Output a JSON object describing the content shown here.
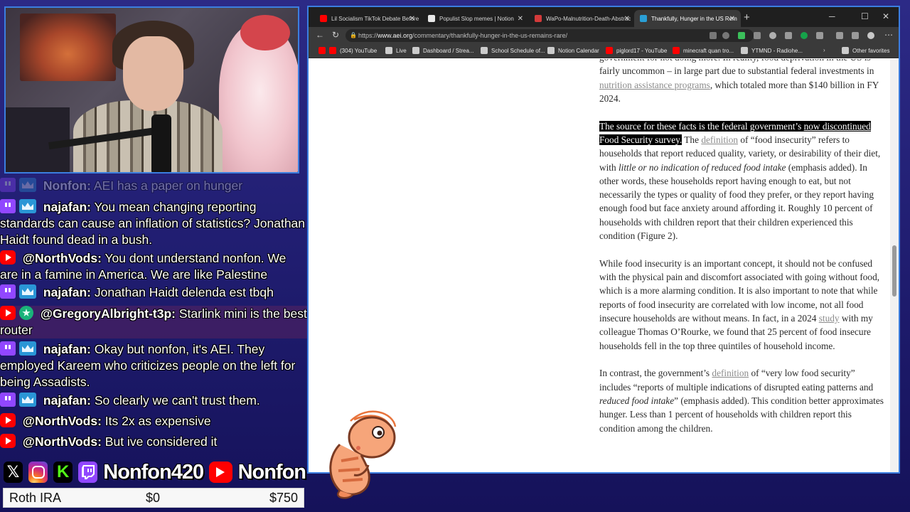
{
  "chat": {
    "messages": [
      {
        "platform": "twitch",
        "badge": "crown",
        "user": "Nonfon:",
        "text": "AEI has a paper on hunger",
        "faded": true
      },
      {
        "platform": "twitch",
        "badge": "crown",
        "user": "najafan:",
        "text": "You mean changing reporting standards can cause an inflation of statistics? Jonathan Haidt found dead in a bush."
      },
      {
        "platform": "youtube",
        "badge": "",
        "user": "@NorthVods:",
        "text": "You dont understand nonfon. We are in a famine in America. We are like Palestine"
      },
      {
        "platform": "twitch",
        "badge": "crown",
        "user": "najafan:",
        "text": "Jonathan Haidt delenda est tbqh"
      },
      {
        "platform": "youtube",
        "badge": "star",
        "user": "@GregoryAlbright-t3p:",
        "text": "Starlink mini is the best router"
      },
      {
        "platform": "twitch",
        "badge": "crown",
        "user": "najafan:",
        "text": "Okay but nonfon, it's AEI. They employed Kareem who criticizes people on the left for being Assadists."
      },
      {
        "platform": "twitch",
        "badge": "crown",
        "user": "najafan:",
        "text": "So clearly we can't trust them."
      },
      {
        "platform": "youtube",
        "badge": "",
        "user": "@NorthVods:",
        "text": "Its 2x as expensive"
      },
      {
        "platform": "youtube",
        "badge": "",
        "user": "@NorthVods:",
        "text": "But ive considered it"
      }
    ]
  },
  "socials": {
    "twitch_name": "Nonfon420",
    "youtube_name": "Nonfon",
    "icons": [
      "x-icon",
      "instagram-icon",
      "kick-icon",
      "twitch-icon",
      "youtube-icon"
    ]
  },
  "roth": {
    "label": "Roth IRA",
    "current": "$0",
    "goal": "$750"
  },
  "browser": {
    "tabs": [
      {
        "title": "Lil Socialism TikTok Debate Before",
        "icon": "youtube-icon",
        "color": "#ff0000",
        "active": false
      },
      {
        "title": "Populist Slop memes | Notion",
        "icon": "notion-icon",
        "color": "#e8e8e8",
        "active": false
      },
      {
        "title": "WaPo-Malnutrition-Death-Abstrac",
        "icon": "pdf-icon",
        "color": "#d33a3a",
        "active": false
      },
      {
        "title": "Thankfully, Hunger in the US Rem",
        "icon": "aei-icon",
        "color": "#2a9fd6",
        "active": true
      }
    ],
    "new_tab": "+",
    "window_controls": {
      "minimize": "─",
      "maximize": "☐",
      "close": "✕"
    },
    "url_prefix": "https://",
    "url_host": "www.aei.org",
    "url_path": "/commentary/thankfully-hunger-in-the-us-remains-rare/",
    "bookmarks": [
      {
        "label": "(304) YouTube",
        "color": "#ff0000"
      },
      {
        "label": "Live",
        "color": "#cccccc"
      },
      {
        "label": "Dashboard / Strea...",
        "color": "#cccccc"
      },
      {
        "label": "School Schedule of...",
        "color": "#cccccc"
      },
      {
        "label": "Notion Calendar",
        "color": "#cccccc"
      },
      {
        "label": "piglord17 - YouTube",
        "color": "#ff0000"
      },
      {
        "label": "minecraft quan tro...",
        "color": "#ff0000"
      },
      {
        "label": "YTMND - Radiohe...",
        "color": "#cccccc"
      },
      {
        "label": "Other favorites",
        "color": "#cccccc"
      }
    ]
  },
  "article": {
    "p1_text": "government for not doing more. In reality, food deprivation in the US is fairly uncommon – in large part due to substantial federal investments in ",
    "p1_link": "nutrition assistance programs",
    "p1_tail": ", which totaled more than $140 billion in FY 2024.",
    "p2_sel_a": "The source for these facts is the federal government’s ",
    "p2_sel_link": "now discontinued",
    "p2_sel_b": " Food Security survey.",
    "p2_mid": " The ",
    "p2_link": "definition",
    "p2_b": " of “food insecurity” refers to households that report reduced quality, variety, or desirability of their diet, with ",
    "p2_em": "little or no indication of reduced food intake",
    "p2_c": " (emphasis added). In other words, these households report having enough to eat, but not necessarily the types or quality of food they prefer, or they report having enough food but face anxiety around affording it. Roughly 10 percent of households with children report that their children experienced this condition (Figure 2).",
    "p3_a": "While food insecurity is an important concept, it should not be confused with the physical pain and discomfort associated with going without food, which is a more alarming condition. It is also important to note that while reports of food insecurity are correlated with low income, not all food insecure households are without means. In fact, in a 2024 ",
    "p3_link": "study",
    "p3_b": " with my colleague Thomas O’Rourke, we found that 25 percent of food insecure households fell in the top three quintiles of household income.",
    "p4_a": "In contrast, the government’s ",
    "p4_link": "definition",
    "p4_b": " of “very low food security” includes “reports of multiple indications of disrupted eating patterns and ",
    "p4_em": "reduced food intake",
    "p4_c": "” (emphasis added). This condition better approximates hunger. Less than 1 percent of households with children report this condition among the children."
  }
}
